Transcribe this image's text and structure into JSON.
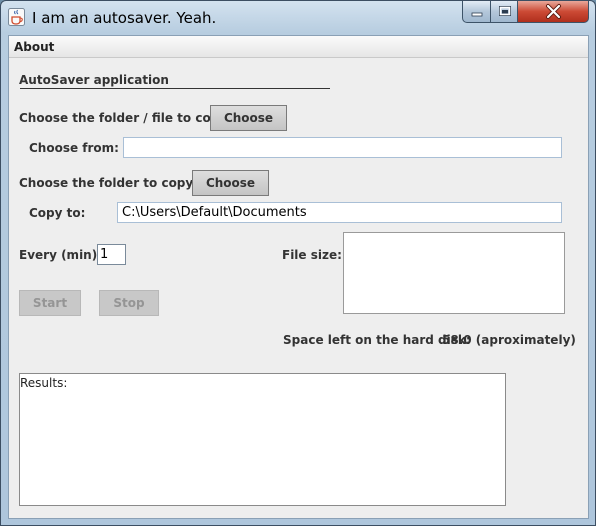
{
  "window": {
    "title": "I am an autosaver. Yeah."
  },
  "menu": {
    "about": "About"
  },
  "header": {
    "title": "AutoSaver application"
  },
  "source": {
    "label": "Choose the folder / file to copy:",
    "button": "Choose",
    "from_label": "Choose from:",
    "from_value": ""
  },
  "destination": {
    "label": "Choose the folder to copy to:",
    "button": "Choose",
    "to_label": "Copy to:",
    "to_value": "C:\\Users\\Default\\Documents"
  },
  "interval": {
    "label": "Every (min):",
    "value": "1"
  },
  "file_size": {
    "label": "File size:",
    "value": ""
  },
  "controls": {
    "start": "Start",
    "stop": "Stop"
  },
  "disk": {
    "label": "Space left on the hard disk:",
    "value": "58.0 (aproximately)"
  },
  "results": {
    "text": "Results:"
  },
  "icons": {
    "app": "java-cup-icon",
    "minimize": "minimize-icon",
    "maximize": "maximize-icon",
    "close": "close-icon"
  },
  "colors": {
    "close_button": "#cc4a35",
    "window_frame": "#b7cde0",
    "panel": "#eeeeee"
  }
}
